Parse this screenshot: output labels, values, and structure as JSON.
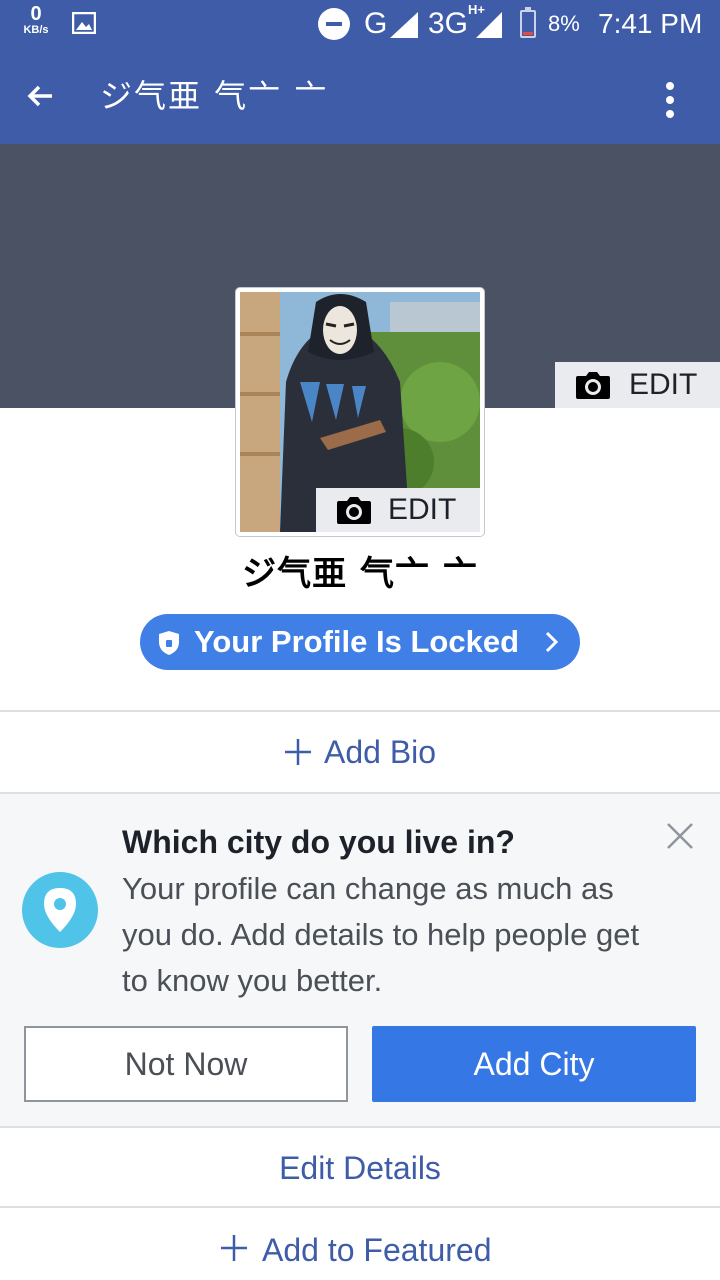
{
  "status_bar": {
    "net_speed_value": "0",
    "net_speed_unit": "KB/s",
    "network_1": "G",
    "network_2": "3G",
    "network_2_sup": "H+",
    "battery": "8%",
    "time": "7:41 PM"
  },
  "app_bar": {
    "title": "ジ气亜 气亠 亠",
    "back_icon": "arrow-left-icon",
    "menu_icon": "more-vert-icon"
  },
  "cover": {
    "edit_label": "EDIT",
    "background_color": "#4b5263"
  },
  "profile": {
    "picture_edit_label": "EDIT",
    "name": "ジ气亜 气亠 亠",
    "locked_label": "Your Profile Is Locked"
  },
  "bio": {
    "add_label": "Add Bio"
  },
  "city_prompt": {
    "title": "Which city do you live in?",
    "body": "Your profile can change as much as you do. Add details to help people get to know you better.",
    "not_now_label": "Not Now",
    "add_city_label": "Add City"
  },
  "details": {
    "edit_label": "Edit Details",
    "add_featured_label": "Add to Featured"
  },
  "colors": {
    "brand": "#3f5ca8",
    "accent": "#3578e5",
    "locked_pill": "#4080e6",
    "pin": "#4fc3e8"
  }
}
